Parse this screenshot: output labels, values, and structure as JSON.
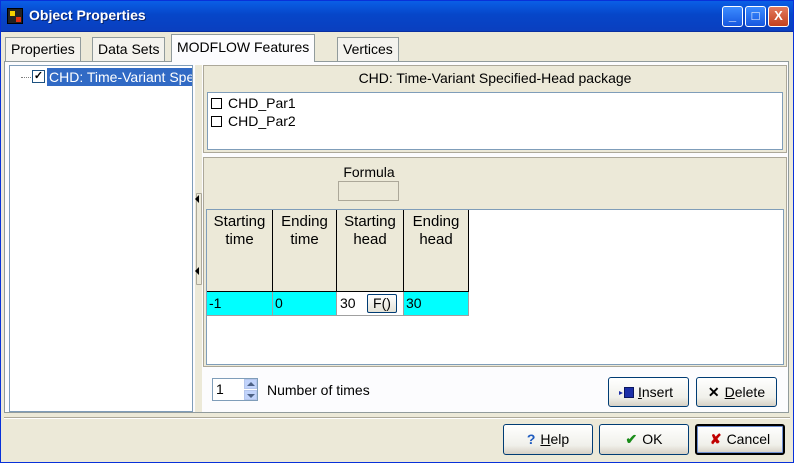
{
  "window": {
    "title": "Object Properties",
    "minimize_glyph": "_",
    "maximize_glyph": "□",
    "close_glyph": "X"
  },
  "tabs": [
    {
      "label": "Properties"
    },
    {
      "label": "Data Sets"
    },
    {
      "label": "MODFLOW Features",
      "active": true
    },
    {
      "label": "Vertices"
    }
  ],
  "tree": {
    "items": [
      {
        "label": "CHD: Time-Variant Specified-Head package",
        "checked": true,
        "check_glyph": "✓"
      }
    ]
  },
  "package": {
    "title": "CHD: Time-Variant Specified-Head package",
    "parameters": [
      {
        "label": "CHD_Par1",
        "checked": false
      },
      {
        "label": "CHD_Par2",
        "checked": false
      }
    ]
  },
  "grid": {
    "formula_label": "Formula",
    "columns": [
      {
        "line1": "Starting",
        "line2": "time"
      },
      {
        "line1": "Ending",
        "line2": "time"
      },
      {
        "line1": "Starting",
        "line2": "head"
      },
      {
        "line1": "Ending",
        "line2": "head"
      }
    ],
    "rows": [
      {
        "starting_time": "-1",
        "ending_time": "0",
        "starting_head": "30",
        "ending_head": "30"
      }
    ],
    "formula_button": "F()"
  },
  "times": {
    "count": "1",
    "label": "Number of times"
  },
  "actions": {
    "insert": {
      "prefix": "",
      "accel": "I",
      "rest": "nsert"
    },
    "delete": {
      "icon": "✕",
      "prefix": "",
      "accel": "D",
      "rest": "elete"
    }
  },
  "footer": {
    "help": {
      "icon": "?",
      "accel": "H",
      "rest": "elp"
    },
    "ok": {
      "icon": "✔",
      "label": "OK"
    },
    "cancel": {
      "icon": "✘",
      "label": "Cancel"
    }
  },
  "colors": {
    "titlebar": "#0646c9",
    "selection": "#316ac5",
    "row_highlight": "#00ffff",
    "ok_icon": "#1a8c1a",
    "cancel_icon": "#c00000",
    "help_icon": "#1f5bbf"
  }
}
